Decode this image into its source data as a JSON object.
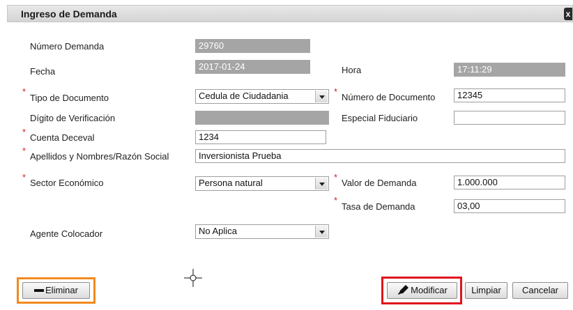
{
  "dialog": {
    "title": "Ingreso de Demanda",
    "close_label": "x"
  },
  "form": {
    "numero_demanda": {
      "label": "Número Demanda",
      "value": "29760"
    },
    "fecha": {
      "label": "Fecha",
      "value": "2017-01-24"
    },
    "hora": {
      "label": "Hora",
      "value": "17:11:29"
    },
    "tipo_documento": {
      "label": "Tipo de Documento",
      "value": "Cedula de Ciudadania"
    },
    "numero_documento": {
      "label": "Número de Documento",
      "value": "12345"
    },
    "digito_verificacion": {
      "label": "Dígito de Verificación",
      "value": ""
    },
    "especial_fiduciario": {
      "label": "Especial Fiduciario",
      "value": ""
    },
    "cuenta_deceval": {
      "label": "Cuenta Deceval",
      "value": "1234"
    },
    "apellidos_nombres": {
      "label": "Apellidos y Nombres/Razón Social",
      "value": "Inversionista Prueba"
    },
    "sector_economico": {
      "label": "Sector Económico",
      "value": "Persona natural"
    },
    "valor_demanda": {
      "label": "Valor de Demanda",
      "value": "1.000.000"
    },
    "tasa_demanda": {
      "label": "Tasa de Demanda",
      "value": "03,00"
    },
    "agente_colocador": {
      "label": "Agente Colocador",
      "value": "No Aplica"
    }
  },
  "required_marker": "*",
  "buttons": {
    "eliminar": "Eliminar",
    "modificar": "Modificar",
    "limpiar": "Limpiar",
    "cancelar": "Cancelar"
  },
  "colors": {
    "readonly_field": "#a5a5a5",
    "required_marker": "#d21f1f",
    "highlight_orange": "#f28a1e",
    "highlight_red": "#e0141e"
  },
  "icons": {
    "eliminar": "minus-icon",
    "modificar": "pencil-icon",
    "cursor": "crosshair-cursor-icon",
    "close": "close-icon"
  }
}
